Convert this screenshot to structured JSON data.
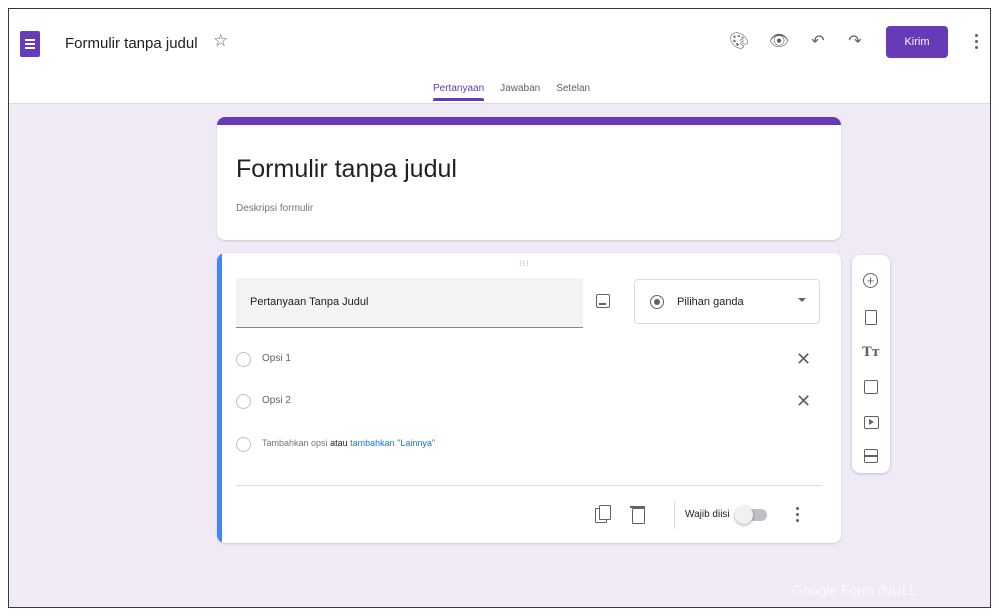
{
  "header": {
    "doc_title": "Formulir tanpa judul",
    "star_icon": "star-outline-icon",
    "icons": [
      "palette-icon",
      "eye-icon",
      "undo-icon",
      "redo-icon"
    ],
    "send_label": "Kirim",
    "more_icon": "more-vert-icon"
  },
  "tabs": [
    {
      "label": "Pertanyaan",
      "active": true
    },
    {
      "label": "Jawaban",
      "active": false
    },
    {
      "label": "Setelan",
      "active": false
    }
  ],
  "form": {
    "title": "Formulir tanpa judul",
    "description_placeholder": "Deskripsi formulir"
  },
  "question": {
    "title": "Pertanyaan Tanpa Judul",
    "type": "Pilihan ganda",
    "options": [
      "Opsi 1",
      "Opsi 2"
    ],
    "add_option": "Tambahkan opsi",
    "or": "atau",
    "add_other": "tambahkan \"Lainnya\"",
    "required_label": "Wajib diisi",
    "required": false
  },
  "toolbar": [
    "add-question-icon",
    "import-question-icon",
    "add-title-icon",
    "add-image-icon",
    "add-video-icon",
    "add-section-icon"
  ],
  "watermark": "Google Form /NULL",
  "colors": {
    "accent": "#673ab7",
    "background": "#efeaf6",
    "focus_bar": "#4285f4",
    "link": "#1a73e8"
  }
}
